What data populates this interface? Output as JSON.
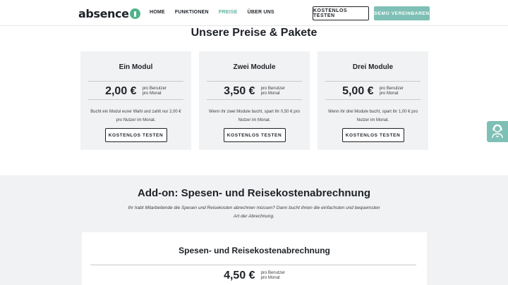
{
  "header": {
    "logo_text": "absence",
    "nav": [
      "HOME",
      "FUNKTIONEN",
      "PREISE",
      "ÜBER UNS"
    ],
    "active_nav": "PREISE",
    "cta_outline": "KOSTENLOS TESTEN",
    "cta_demo": "DEMO VEREINBAREN"
  },
  "pricing": {
    "title": "Unsere Preise & Pakete",
    "cards": [
      {
        "name": "Ein Modul",
        "price": "2,00 €",
        "per1": "pro Benutzer",
        "per2": "pro Monat",
        "desc": "Bucht ein Modul eurer Wahl und zahlt nur 2,00 € pro Nutzer im Monat.",
        "button": "KOSTENLOS TESTEN"
      },
      {
        "name": "Zwei Module",
        "price": "3,50 €",
        "per1": "pro Benutzer",
        "per2": "pro Monat",
        "desc": "Wenn ihr zwei Module bucht, spart ihr 0,50 € pro Nutzer im Monat.",
        "button": "KOSTENLOS TESTEN"
      },
      {
        "name": "Drei Module",
        "price": "5,00 €",
        "per1": "pro Benutzer",
        "per2": "pro Monat",
        "desc": "Wenn ihr drei Module bucht, spart ihr 1,00 € pro Nutzer im Monat.",
        "button": "KOSTENLOS TESTEN"
      }
    ]
  },
  "addon": {
    "title": "Add-on: Spesen- und Reisekostenabrechnung",
    "desc": "Ihr habt Mitarbeitende die Spesen und Reisekosten abrechnen müssen? Dann bucht ihnen die einfachsten und bequemsten Art der Abrechnung.",
    "card": {
      "name": "Spesen- und Reisekostenabrechnung",
      "price": "4,50 €",
      "per1": "pro Benutzer",
      "per2": "pro Monat"
    }
  },
  "colors": {
    "accent": "#7ec0b5",
    "brand_green": "#4fb38a",
    "card_bg": "#f1f2f3"
  },
  "icons": {
    "side_widget": "support-agent-icon"
  }
}
